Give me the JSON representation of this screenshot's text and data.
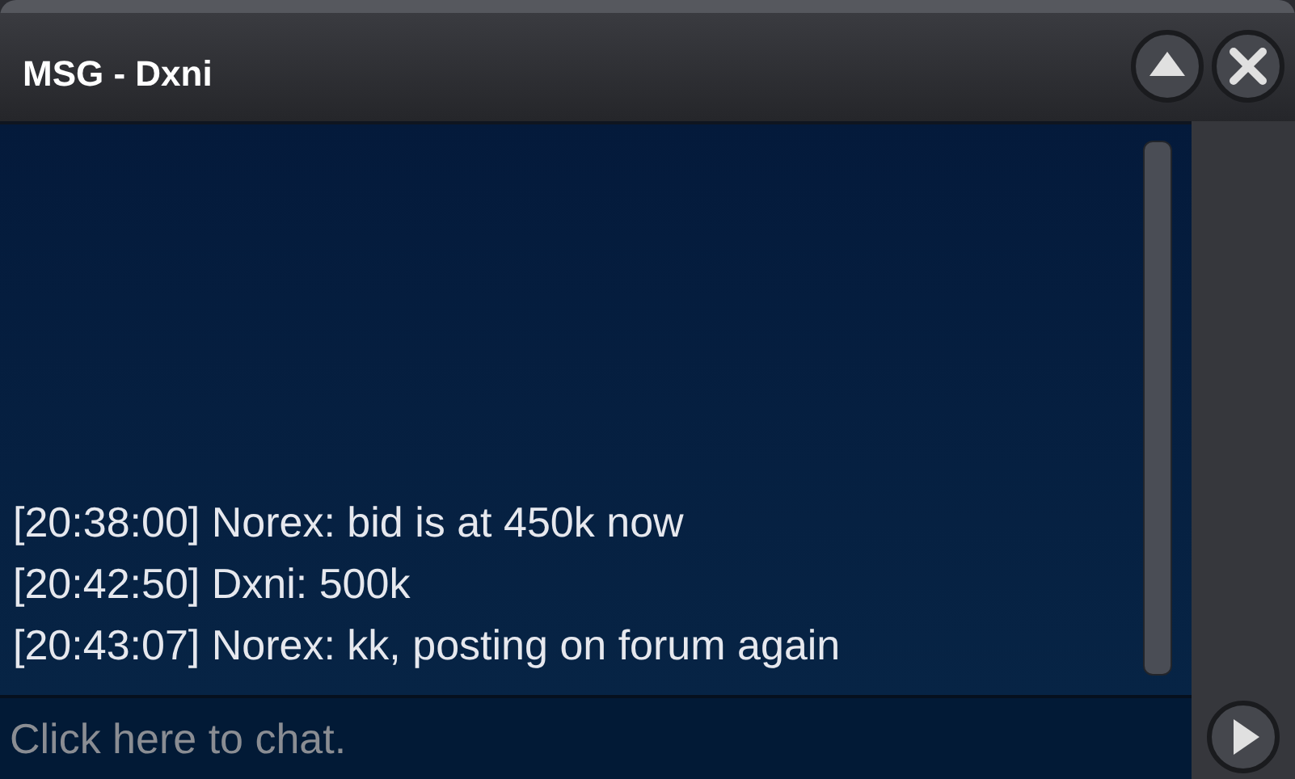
{
  "window": {
    "title": "MSG - Dxni"
  },
  "messages": [
    {
      "text": "[20:38:00] Norex: bid is at 450k now"
    },
    {
      "text": "[20:42:50] Dxni: 500k"
    },
    {
      "text": "[20:43:07] Norex: kk, posting on forum again"
    }
  ],
  "input": {
    "placeholder": "Click here to chat."
  }
}
